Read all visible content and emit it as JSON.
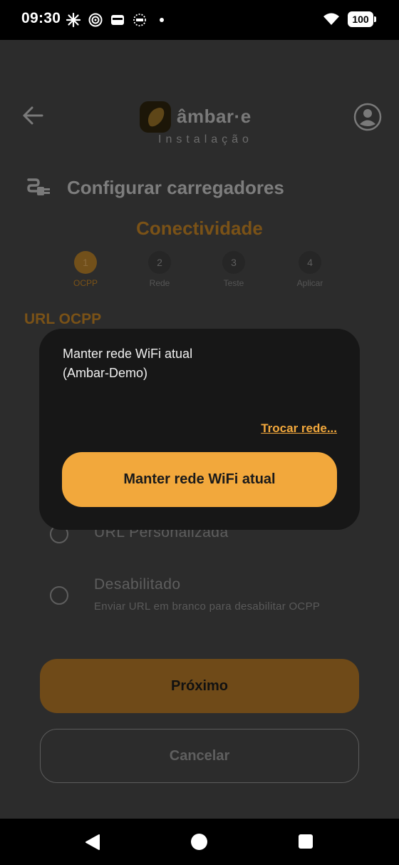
{
  "status_bar": {
    "time": "09:30",
    "battery": "100"
  },
  "header": {
    "brand": "âmbar·e",
    "subtitle": "Instalação"
  },
  "page": {
    "title": "Configurar carregadores",
    "step_heading": "Conectividade"
  },
  "stepper": [
    {
      "number": "1",
      "label": "OCPP"
    },
    {
      "number": "2",
      "label": "Rede"
    },
    {
      "number": "3",
      "label": "Teste"
    },
    {
      "number": "4",
      "label": "Aplicar"
    }
  ],
  "section": {
    "heading": "URL OCPP"
  },
  "options": {
    "custom": {
      "label": "URL Personalizada"
    },
    "disabled": {
      "label": "Desabilitado",
      "sub": "Enviar URL em branco para desabilitar OCPP"
    }
  },
  "actions": {
    "next": "Próximo",
    "cancel": "Cancelar"
  },
  "dialog": {
    "message": "Manter rede WiFi atual\n(Ambar-Demo)",
    "link": "Trocar rede...",
    "primary": "Manter rede WiFi atual"
  },
  "colors": {
    "accent": "#f2a83c",
    "dim_accent": "#7a5217",
    "surface": "#171717"
  }
}
